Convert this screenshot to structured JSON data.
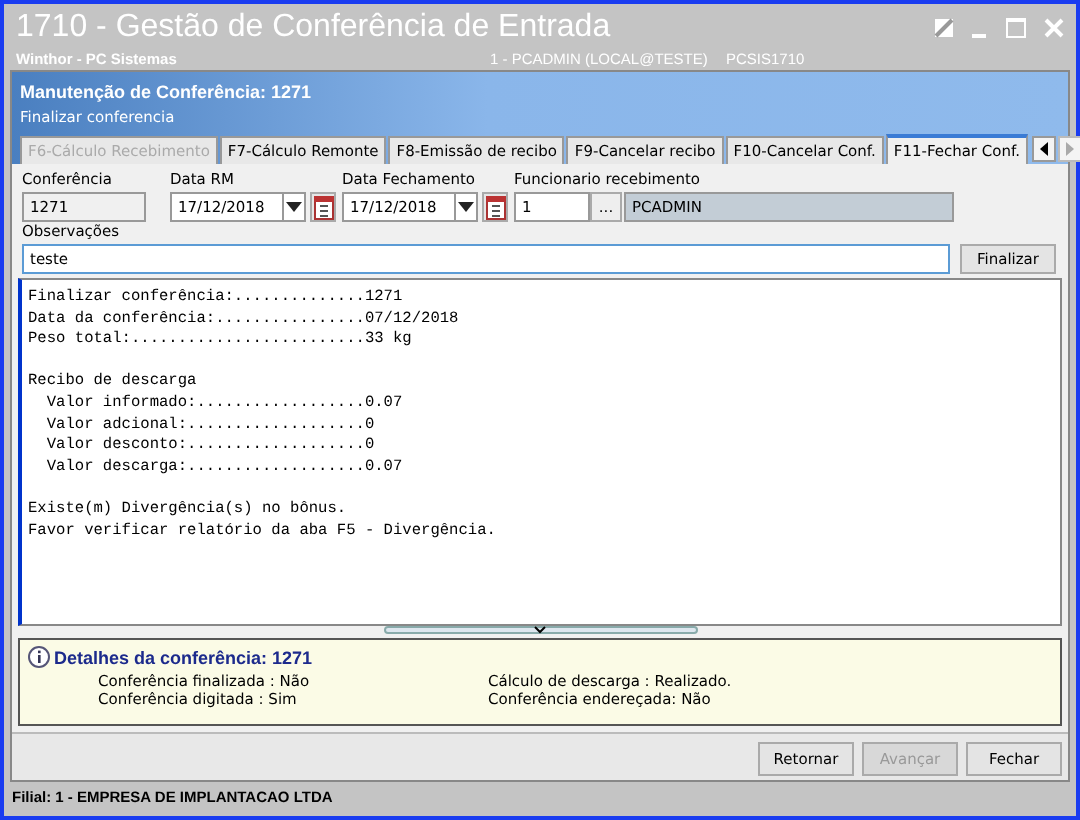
{
  "window": {
    "title": "1710 - Gestão de Conferência de Entrada",
    "subtitle": "Winthor - PC Sistemas",
    "session": "1 - PCADMIN (LOCAL@TESTE)",
    "program": "PCSIS1710"
  },
  "header": {
    "title": "Manutenção de Conferência: 1271",
    "subtitle": "Finalizar conferencia"
  },
  "tabs": [
    {
      "label": "F6-Cálculo Recebimento",
      "selected": false,
      "disabled": true
    },
    {
      "label": "F7-Cálculo Remonte",
      "selected": false,
      "disabled": false
    },
    {
      "label": "F8-Emissão de recibo",
      "selected": false,
      "disabled": false
    },
    {
      "label": "F9-Cancelar recibo",
      "selected": false,
      "disabled": false
    },
    {
      "label": "F10-Cancelar Conf.",
      "selected": false,
      "disabled": false
    },
    {
      "label": "F11-Fechar Conf.",
      "selected": true,
      "disabled": false
    }
  ],
  "form": {
    "conferencia": {
      "label": "Conferência",
      "value": "1271"
    },
    "data_rm": {
      "label": "Data RM",
      "value": "17/12/2018"
    },
    "data_fechamento": {
      "label": "Data Fechamento",
      "value": "17/12/2018"
    },
    "funcionario": {
      "label": "Funcionario recebimento",
      "code": "1",
      "lookup": "...",
      "name": "PCADMIN"
    },
    "observacoes": {
      "label": "Observações",
      "value": "teste"
    },
    "finalizar": "Finalizar"
  },
  "report": [
    [
      "Finalizar conferência:..............1271",
      "Data da conferência:................07/12/2018",
      "Peso total:.........................33 kg"
    ],
    [
      "Recibo de descarga",
      "  Valor informado:..................0.07",
      "  Valor adcional:...................0",
      "  Valor desconto:...................0",
      "  Valor descarga:...................0.07"
    ],
    [
      "Existe(m) Divergência(s) no bônus.",
      "Favor verificar relatório da aba F5 - Divergência."
    ]
  ],
  "details": {
    "title": "Detalhes da conferência: 1271",
    "items": [
      "Conferência finalizada : Não",
      "Cálculo de descarga : Realizado.",
      "Conferência digitada : Sim",
      "Conferência endereçada: Não"
    ]
  },
  "buttons": [
    {
      "label": "Retornar",
      "disabled": false
    },
    {
      "label": "Avançar",
      "disabled": true
    },
    {
      "label": "Fechar",
      "disabled": false
    }
  ],
  "status_bar": "Filial: 1 - EMPRESA DE IMPLANTACAO LTDA"
}
